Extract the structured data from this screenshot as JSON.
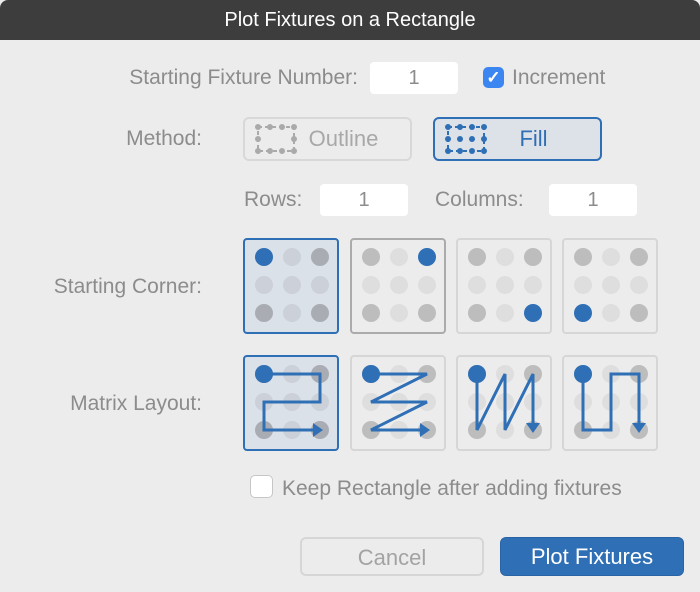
{
  "window": {
    "title": "Plot Fixtures on a Rectangle"
  },
  "start_number": {
    "label": "Starting Fixture Number:",
    "value": "1"
  },
  "increment": {
    "label": "Increment",
    "checked": true,
    "check_glyph": "✓"
  },
  "method": {
    "label": "Method:",
    "options": [
      {
        "label": "Outline",
        "icon": "outline-rect-icon",
        "selected": false
      },
      {
        "label": "Fill",
        "icon": "fill-rect-icon",
        "selected": true
      }
    ]
  },
  "rows": {
    "label": "Rows:",
    "value": "1"
  },
  "columns": {
    "label": "Columns:",
    "value": "1"
  },
  "starting_corner": {
    "label": "Starting Corner:",
    "options": [
      "top-left-corner-icon",
      "top-right-corner-icon",
      "bottom-right-corner-icon",
      "bottom-left-corner-icon"
    ],
    "selected_index": 0
  },
  "matrix_layout": {
    "label": "Matrix Layout:",
    "options": [
      "row-snake-layout-icon",
      "row-zigzag-layout-icon",
      "column-zigzag-layout-icon",
      "column-snake-layout-icon"
    ],
    "selected_index": 0
  },
  "keep_rectangle": {
    "label": "Keep Rectangle after adding fixtures",
    "checked": false
  },
  "buttons": {
    "cancel": "Cancel",
    "plot": "Plot Fixtures"
  },
  "colors": {
    "accent": "#2f6fb5",
    "titlebar": "#3d3d3d",
    "background": "#ececec"
  }
}
